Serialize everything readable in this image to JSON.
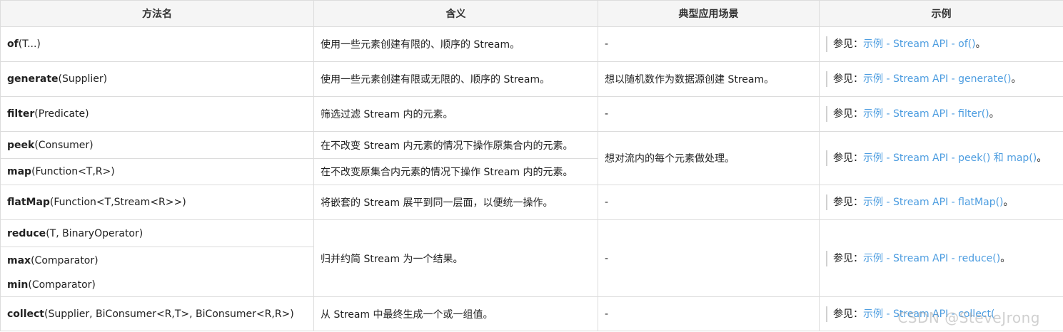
{
  "headers": [
    "方法名",
    "含义",
    "典型应用场景",
    "示例"
  ],
  "ex_prefix": "参见：",
  "rows": {
    "of": {
      "name": "of",
      "params": "(T...)",
      "meaning": "使用一些元素创建有限的、顺序的 Stream。",
      "scene": "-",
      "link": "示例 - Stream API - of()",
      "suffix": "。"
    },
    "generate": {
      "name": "generate",
      "params": "(Supplier)",
      "meaning": "使用一些元素创建有限或无限的、顺序的 Stream。",
      "scene": "想以随机数作为数据源创建 Stream。",
      "link": "示例 - Stream API - generate()",
      "suffix": "。"
    },
    "filter": {
      "name": "filter",
      "params": "(Predicate)",
      "meaning": "筛选过滤 Stream 内的元素。",
      "scene": "-",
      "link": "示例 - Stream API - filter()",
      "suffix": "。"
    },
    "peek": {
      "name": "peek",
      "params": "(Consumer)",
      "meaning": "在不改变 Stream 内元素的情况下操作原集合内的元素。"
    },
    "map": {
      "name": "map",
      "params": "(Function<T,R>)",
      "meaning": "在不改变原集合内元素的情况下操作 Stream 内的元素。"
    },
    "peekmap": {
      "scene": "想对流内的每个元素做处理。",
      "link": "示例 - Stream API - peek() 和 map()",
      "suffix": "。"
    },
    "flatMap": {
      "name": "flatMap",
      "params": "(Function<T,Stream<R>>)",
      "meaning": "将嵌套的 Stream 展平到同一层面，以便统一操作。",
      "scene": "-",
      "link": "示例 - Stream API - flatMap()",
      "suffix": "。"
    },
    "reduce": {
      "name": "reduce",
      "params": "(T, BinaryOperator)"
    },
    "max": {
      "name": "max",
      "params": "(Comparator)"
    },
    "min": {
      "name": "min",
      "params": "(Comparator)"
    },
    "reducegroup": {
      "meaning": "归并约简 Stream 为一个结果。",
      "scene": "-",
      "link": "示例 - Stream API - reduce()",
      "suffix": "。"
    },
    "collect": {
      "name": "collect",
      "params": "(Supplier, BiConsumer<R,T>, BiConsumer<R,R>)",
      "meaning": "从 Stream 中最终生成一个或一组值。",
      "scene": "-",
      "link": "示例 - Stream API - collect("
    }
  },
  "watermark": "CSDN @SteveJrong"
}
